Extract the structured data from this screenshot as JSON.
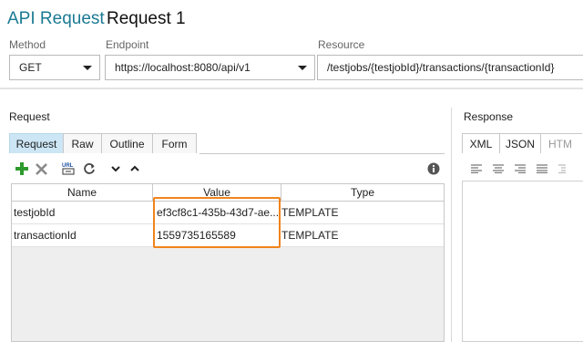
{
  "header": {
    "title": "API Request",
    "subtitle": "Request 1"
  },
  "fields": {
    "method_label": "Method",
    "method_value": "GET",
    "endpoint_label": "Endpoint",
    "endpoint_value": "https://localhost:8080/api/v1",
    "resource_label": "Resource",
    "resource_value": "/testjobs/{testjobId}/transactions/{transactionId}"
  },
  "request": {
    "label": "Request",
    "tabs": [
      "Request",
      "Raw",
      "Outline",
      "Form"
    ],
    "active_tab": "Request",
    "toolbar_icons": [
      "add-icon",
      "delete-icon",
      "url-encode-icon",
      "refresh-icon",
      "move-down-icon",
      "move-up-icon",
      "info-icon"
    ],
    "columns": [
      "Name",
      "Value",
      "Type"
    ],
    "rows": [
      {
        "name": "testjobId",
        "value": "ef3cf8c1-435b-43d7-ae...",
        "type": "TEMPLATE"
      },
      {
        "name": "transactionId",
        "value": "1559735165589",
        "type": "TEMPLATE"
      }
    ]
  },
  "response": {
    "label": "Response",
    "tabs": [
      "XML",
      "JSON",
      "HTM"
    ],
    "toolbar_icons": [
      "align-left-icon",
      "align-center-icon",
      "align-right-icon",
      "align-justify-icon",
      "indent-icon"
    ]
  },
  "colors": {
    "accent": "#1b7a93",
    "active_tab": "#cce6f5",
    "highlight": "#f0841a",
    "add_green": "#2e9a2e"
  }
}
